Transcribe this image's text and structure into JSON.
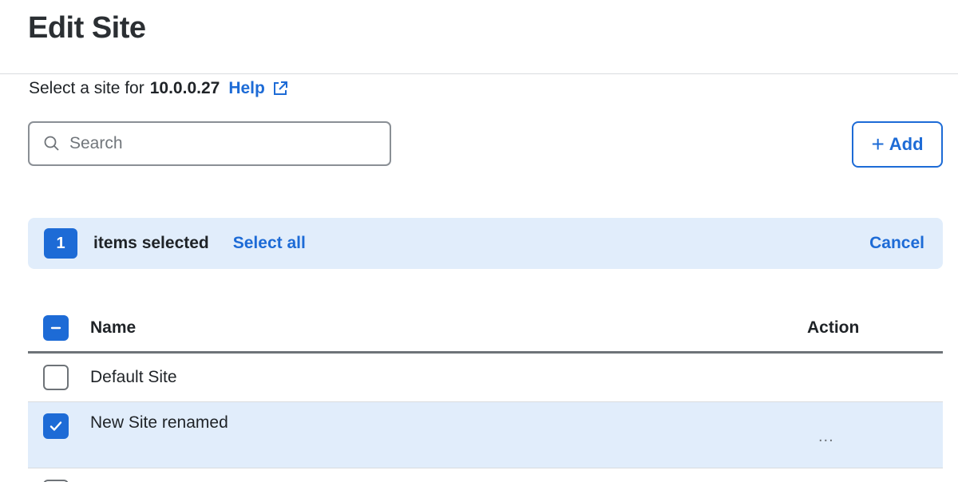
{
  "page": {
    "title": "Edit Site"
  },
  "subtitle": {
    "prefix": "Select a site for",
    "ip": "10.0.0.27",
    "help_label": "Help"
  },
  "search": {
    "placeholder": "Search",
    "value": ""
  },
  "toolbar": {
    "add_label": "Add"
  },
  "selection": {
    "count": "1",
    "text": "items selected",
    "select_all_label": "Select all",
    "cancel_label": "Cancel"
  },
  "table": {
    "columns": [
      "Name",
      "Action"
    ],
    "rows": [
      {
        "name": "Default Site",
        "checked": false,
        "action": ""
      },
      {
        "name": "New Site renamed",
        "checked": true,
        "action": "..."
      }
    ]
  },
  "colors": {
    "accent": "#1d6bd6",
    "selection_bg": "#e1edfb",
    "text": "#1f2327"
  }
}
